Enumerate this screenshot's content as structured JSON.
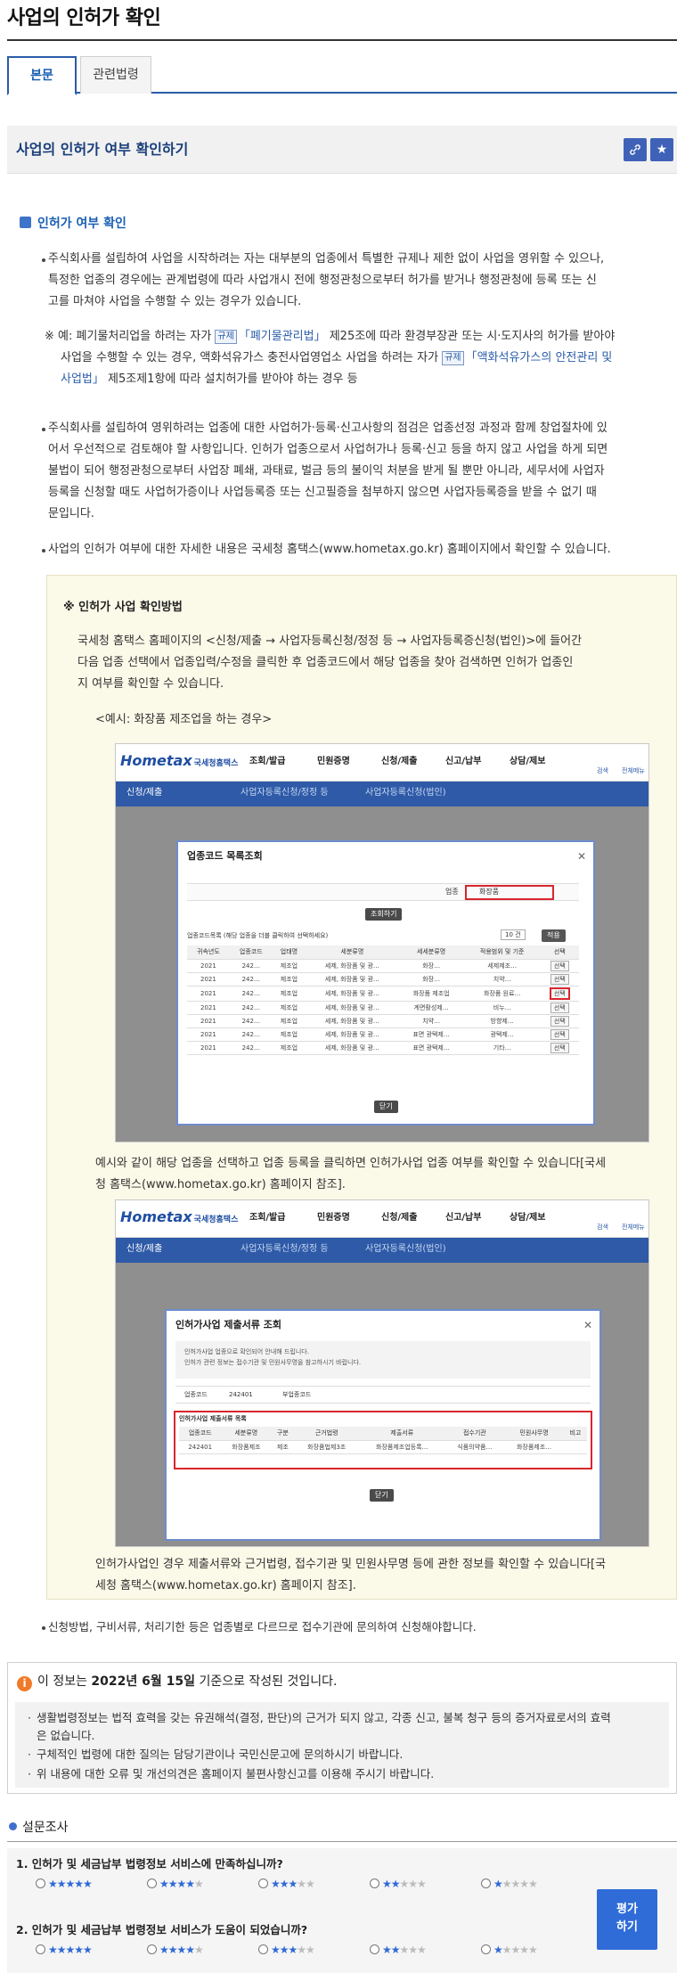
{
  "page": {
    "title": "사업의 인허가 확인"
  },
  "tabs": [
    {
      "label": "본문"
    },
    {
      "label": "관련법령"
    }
  ],
  "section": {
    "title": "사업의 인허가 여부 확인하기",
    "link_icon": "link-icon",
    "bookmark_icon": "star-icon"
  },
  "content": {
    "subheading": "인허가 여부 확인",
    "p1_lines": [
      "주식회사를 설립하여 사업을 시작하려는 자는 대부분의 업종에서 특별한 규제나 제한 없이 사업을 영위할 수 있으나,",
      "특정한 업종의 경우에는 관계법령에 따라 사업개시 전에 행정관청으로부터 허가를 받거나 행정관청에 등록 또는 신",
      "고를 마쳐야 사업을 수행할 수 있는 경우가 있습니다."
    ],
    "note": {
      "line1_a": "※ 예: 폐기물처리업을 하려는 자가 ",
      "tag": "규제",
      "law1": "「폐기물관리법」",
      "line1_b": " 제25조에 따라 환경부장관 또는 시·도지사의 허가를 받아야",
      "line2_a": "사업을 수행할 수 있는 경우, 액화석유가스 충전사업영업소 사업을 하려는 자가 ",
      "law2": "「액화석유가스의 안전관리 및",
      "line3_law": "사업법」",
      "line3_b": " 제5조제1항에 따라 설치허가를 받아야 하는 경우 등"
    },
    "p2_lines": [
      "주식회사를 설립하여 영위하려는 업종에 대한 사업허가·등록·신고사항의 점검은 업종선정 과정과 함께 창업절차에 있",
      "어서 우선적으로 검토해야 할 사항입니다. 인허가 업종으로서 사업허가나 등록·신고 등을 하지 않고 사업을 하게 되면",
      "불법이 되어 행정관청으로부터 사업장 폐쇄, 과태료, 벌금 등의 불이익 처분을 받게 될 뿐만 아니라, 세무서에 사업자",
      "등록을 신청할 때도 사업허가증이나 사업등록증 또는 신고필증을 첨부하지 않으면 사업자등록증을 받을 수 없기 때",
      "문입니다."
    ],
    "p3": "사업의 인허가 여부에 대한 자세한 내용은 국세청 홈택스(www.hometax.go.kr) 홈페이지에서 확인할 수 있습니다.",
    "guide": {
      "title": "※ 인허가 사업 확인방법",
      "lines": [
        "국세청 홈택스 홈페이지의 <신청/제출 → 사업자등록신청/정정 등 → 사업자등록증신청(법인)>에 들어간",
        "다음 업종 선택에서 업종입력/수정을 클릭한 후 업종코드에서 해당 업종을 찾아 검색하면 인허가 업종인",
        "지 여부를 확인할 수 있습니다."
      ],
      "example": "<예시: 화장품 제조업을 하는 경우>",
      "after_shot1_lines": [
        "예시와 같이 해당 업종을 선택하고 업종 등록을 클릭하면 인허가사업 업종 여부를 확인할 수 있습니다[국세",
        "청 홈택스(www.hometax.go.kr) 홈페이지 참조]."
      ],
      "after_shot2_lines": [
        "인허가사업인 경우 제출서류와 근거법령, 접수기관 및 민원사무명 등에 관한 정보를 확인할 수 있습니다[국",
        "세청 홈택스(www.hometax.go.kr) 홈페이지 참조]."
      ]
    },
    "p4": "신청방법, 구비서류, 처리기한 등은 업종별로 다르므로 접수기관에 문의하여 신청해야합니다."
  },
  "shot1": {
    "logo": "Hometax",
    "logo_sub": "국세청홈택스",
    "menus": [
      "조회/발급",
      "민원증명",
      "신청/제출",
      "신고/납부",
      "상담/제보"
    ],
    "right_icons": [
      "검색",
      "전체메뉴"
    ],
    "nav": [
      "신청/제출",
      "사업자등록신청/정정 등",
      "사업자등록신청(법인)"
    ],
    "modal_title": "업종코드 목록조회",
    "search_label": "업종",
    "search_value": "화장품",
    "search_button": "조회하기",
    "result_header": "업종코드목록 (해당 업종을 더블 클릭하여 선택하세요)",
    "per_page": "10 건",
    "per_page_button": "적용",
    "columns": [
      "귀속년도",
      "업종코드",
      "업태명",
      "세분류명",
      "세세분류명",
      "적용범위 및 기준",
      "선택"
    ],
    "rows": [
      [
        "2021",
        "242…",
        "제조업",
        "세제, 화장품 및 광…",
        "화장…",
        "세제제조…",
        "선택"
      ],
      [
        "2021",
        "242…",
        "제조업",
        "세제, 화장품 및 광…",
        "화장…",
        "치약…",
        "선택"
      ],
      [
        "2021",
        "242…",
        "제조업",
        "세제, 화장품 및 광…",
        "화장품 제조업",
        "화장품 원료…",
        "선택"
      ],
      [
        "2021",
        "242…",
        "제조업",
        "세제, 화장품 및 광…",
        "계면활성제…",
        "비누…",
        "선택"
      ],
      [
        "2021",
        "242…",
        "제조업",
        "세제, 화장품 및 광…",
        "치약…",
        "방향제…",
        "선택"
      ],
      [
        "2021",
        "242…",
        "제조업",
        "세제, 화장품 및 광…",
        "표면 광택제…",
        "광택제…",
        "선택"
      ],
      [
        "2021",
        "242…",
        "제조업",
        "세제, 화장품 및 광…",
        "표면 광택제…",
        "기타…",
        "선택"
      ]
    ],
    "close_button": "닫기"
  },
  "shot2": {
    "logo": "Hometax",
    "logo_sub": "국세청홈택스",
    "menus": [
      "조회/발급",
      "민원증명",
      "신청/제출",
      "신고/납부",
      "상담/제보"
    ],
    "right_icons": [
      "검색",
      "전체메뉴"
    ],
    "nav": [
      "신청/제출",
      "사업자등록신청/정정 등",
      "사업자등록신청(법인)"
    ],
    "modal_title": "인허가사업 제출서류 조회",
    "info_lines": [
      "인허가사업 업종으로 확인되어 안내해 드립니다.",
      "인허가 관련 정보는 접수기관 및 민원사무명을 참고하시기 바랍니다."
    ],
    "code_label": "업종코드",
    "code_value": "242401",
    "type_label": "부업종코드",
    "table_title": "인허가사업 제출서류 목록",
    "columns": [
      "업종코드",
      "세분류명",
      "구분",
      "근거법령",
      "제출서류",
      "접수기관",
      "민원사무명",
      "비고"
    ],
    "rows": [
      [
        "242401",
        "화장품제조",
        "제조",
        "화장품법제3조",
        "화장품제조업등록…",
        "식품의약품…",
        "화장품제조…",
        ""
      ]
    ],
    "close_button": "닫기"
  },
  "info": {
    "head_a": "이 정보는 ",
    "head_date": "2022년 6월 15일",
    "head_b": " 기준으로 작성된 것입니다.",
    "items": [
      "생활법령정보는 법적 효력을 갖는 유권해석(결정, 판단)의 근거가 되지 않고, 각종 신고, 불복 청구 등의 증거자료로서의 효력",
      "은 없습니다.",
      "구체적인 법령에 대한 질의는 담당기관이나 국민신문고에 문의하시기 바랍니다.",
      "위 내용에 대한 오류 및 개선의견은 홈페이지 불편사항신고를 이용해 주시기 바랍니다."
    ]
  },
  "survey": {
    "title": "설문조사",
    "q1": "1.  인허가 및 세금납부 법령정보 서비스에 만족하십니까?",
    "q2": "2.  인허가 및 세금납부 법령정보 서비스가 도움이 되었습니까?",
    "ratings": [
      5,
      4,
      3,
      2,
      1
    ],
    "button": "평가\n하기",
    "button_line1": "평가",
    "button_line2": "하기"
  },
  "colors": {
    "accent": "#2a5ca8",
    "guide_bg": "#fbf9e8",
    "highlight_red": "#d7262e",
    "star_on": "#2f6ad6",
    "alert": "#f07a29"
  }
}
